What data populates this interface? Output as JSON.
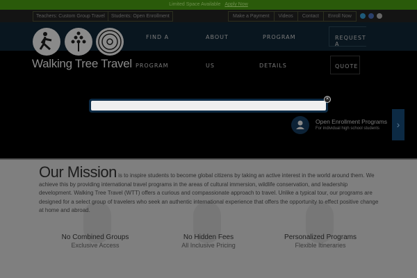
{
  "announcement": {
    "text": "Limited Space Available",
    "link": "Apply Now"
  },
  "topbar": {
    "left": [
      "Teachers: Custom Group Travel",
      "Students: Open Enrollment"
    ],
    "right": [
      "Make a Payment",
      "Videos",
      "Contact",
      "Enroll Now"
    ],
    "social": [
      "twitter-icon",
      "facebook-icon",
      "instagram-icon"
    ]
  },
  "logo": {
    "text": "Walking Tree Travel"
  },
  "nav": [
    {
      "l1": "FIND A",
      "l2": "PROGRAM"
    },
    {
      "l1": "ABOUT",
      "l2": "US"
    },
    {
      "l1": "PROGRAM",
      "l2": "DETAILS"
    },
    {
      "l1": "REQUEST A",
      "l2": "QUOTE"
    }
  ],
  "promo": {
    "title": "Open Enrollment Programs",
    "subtitle": "For individual high school students"
  },
  "mission": {
    "heading": "Our Mission",
    "body": " is to inspire students to become global citizens by taking an active interest in the world around them. We achieve this by providing international travel programs in the areas of cultural immersion, wildlife conservation, and leadership development. Walking Tree Travel (WTT) offers a curious and compassionate approach to travel. Unlike a typical tour, our programs are designed for a select group of travelers who seek an authentic international experience that offers the opportunity to effect positive change at home and abroad."
  },
  "features": [
    {
      "title": "No Combined Groups",
      "sub": "Exclusive Access"
    },
    {
      "title": "No Hidden Fees",
      "sub": "All Inclusive Pricing"
    },
    {
      "title": "Personalized Programs",
      "sub": "Flexible Itineraries"
    }
  ]
}
